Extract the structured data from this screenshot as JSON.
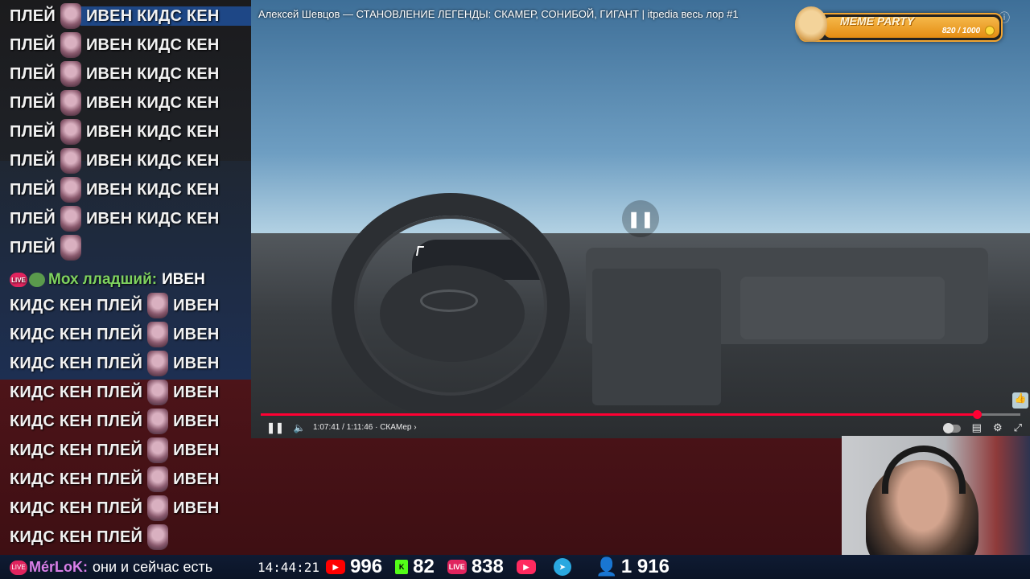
{
  "chat": {
    "lines": [
      {
        "pre": "ПЛЕЙ",
        "post": "ИВЕН КИДС КЕН"
      },
      {
        "pre": "ПЛЕЙ",
        "post": "ИВЕН КИДС КЕН"
      },
      {
        "pre": "ПЛЕЙ",
        "post": "ИВЕН КИДС КЕН"
      },
      {
        "pre": "ПЛЕЙ",
        "post": "ИВЕН КИДС КЕН"
      },
      {
        "pre": "ПЛЕЙ",
        "post": "ИВЕН КИДС КЕН"
      },
      {
        "pre": "ПЛЕЙ",
        "post": "ИВЕН КИДС КЕН"
      },
      {
        "pre": "ПЛЕЙ",
        "post": "ИВЕН КИДС КЕН"
      },
      {
        "pre": "ПЛЕЙ",
        "post": "ИВЕН КИДС КЕН"
      },
      {
        "pre": "ПЛЕЙ",
        "post": ""
      }
    ],
    "user_message": {
      "badge": "LIVE",
      "username": "Мох лладший:",
      "text": "ИВЕН"
    },
    "lines2": [
      {
        "pre": "КИДС КЕН ПЛЕЙ",
        "post": "ИВЕН"
      },
      {
        "pre": "КИДС КЕН ПЛЕЙ",
        "post": "ИВЕН"
      },
      {
        "pre": "КИДС КЕН ПЛЕЙ",
        "post": "ИВЕН"
      },
      {
        "pre": "КИДС КЕН ПЛЕЙ",
        "post": "ИВЕН"
      },
      {
        "pre": "КИДС КЕН ПЛЕЙ",
        "post": "ИВЕН"
      },
      {
        "pre": "КИДС КЕН ПЛЕЙ",
        "post": "ИВЕН"
      },
      {
        "pre": "КИДС КЕН ПЛЕЙ",
        "post": "ИВЕН"
      },
      {
        "pre": "КИДС КЕН ПЛЕЙ",
        "post": "ИВЕН"
      },
      {
        "pre": "КИДС КЕН ПЛЕЙ",
        "post": ""
      }
    ]
  },
  "video": {
    "title": "Алексей Шевцов — СТАНОВЛЕНИЕ ЛЕГЕНДЫ: СКАМЕР, СОНИБОЙ, ГИГАНТ | itpedia весь лор #1",
    "time": "1:07:41 / 1:11:46 · СКАМер ›",
    "progress_fraction": 0.943,
    "play_icon": "pause-icon",
    "accent_color": "#ff0033"
  },
  "meme_party": {
    "title": "MEME PARTY",
    "count": "820 / 1000"
  },
  "bottom": {
    "nick": "MérLoK:",
    "message": "они и сейчас есть",
    "badge": "LIVE",
    "clock": "14:44:21",
    "youtube": "996",
    "kick": "82",
    "vk": "838",
    "vk_badge": "LIVE",
    "viewers": "1 916"
  }
}
